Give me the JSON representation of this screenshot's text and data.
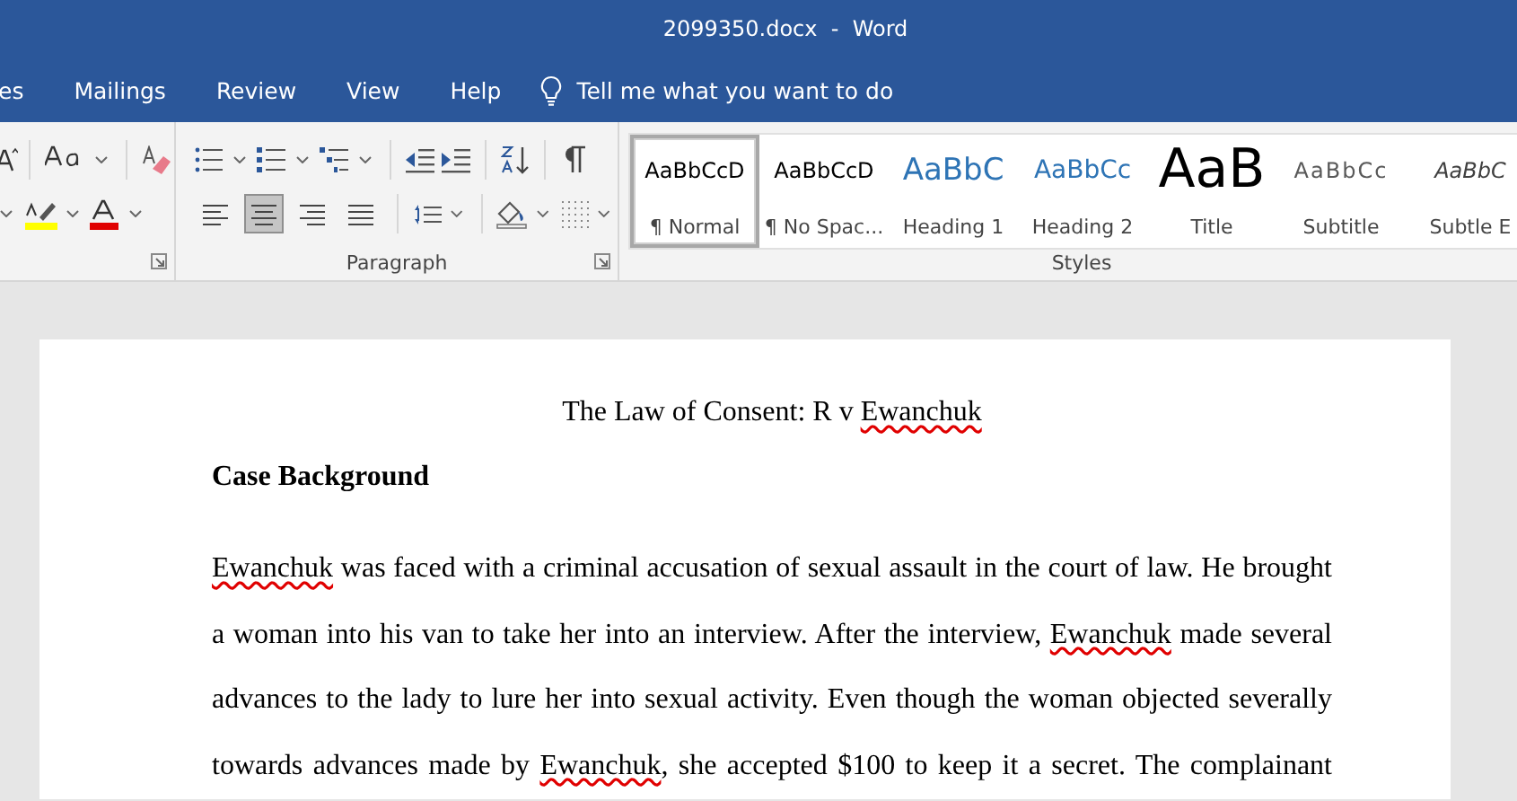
{
  "window": {
    "title": "2099350.docx  -  Word"
  },
  "tabs": [
    {
      "label": "es",
      "selected": false
    },
    {
      "label": "Mailings",
      "selected": false
    },
    {
      "label": "Review",
      "selected": false
    },
    {
      "label": "View",
      "selected": false
    },
    {
      "label": "Help",
      "selected": false
    }
  ],
  "tell_me": {
    "label": "Tell me what you want to do"
  },
  "ribbon": {
    "paragraph": {
      "label": "Paragraph",
      "alignment": [
        {
          "selected": false
        },
        {
          "selected": true
        },
        {
          "selected": false
        },
        {
          "selected": false
        }
      ]
    },
    "styles": {
      "label": "Styles",
      "items": [
        {
          "preview": "AaBbCcD",
          "name": "¶ Normal",
          "kind": "normal",
          "selected": true
        },
        {
          "preview": "AaBbCcD",
          "name": "¶ No Spac...",
          "kind": "normal",
          "selected": false
        },
        {
          "preview": "AaBbC",
          "name": "Heading 1",
          "kind": "heading1",
          "selected": false
        },
        {
          "preview": "AaBbCc",
          "name": "Heading 2",
          "kind": "heading2",
          "selected": false
        },
        {
          "preview": "AaB",
          "name": "Title",
          "kind": "title",
          "selected": false
        },
        {
          "preview": "AaBbCc",
          "name": "Subtitle",
          "kind": "subtitle",
          "selected": false
        },
        {
          "preview": "AaBbC",
          "name": "Subtle E",
          "kind": "emphasis",
          "selected": false
        }
      ]
    }
  },
  "document": {
    "title": [
      {
        "text": "The Law of Consent: R v ",
        "misspelled": false
      },
      {
        "text": "Ewanchuk",
        "misspelled": true
      }
    ],
    "heading": "Case Background",
    "paragraph": [
      {
        "text": "Ewanchuk",
        "misspelled": true
      },
      {
        "text": " was faced with a criminal accusation of sexual assault in the court of law. He brought a woman into his van to take her into an interview. After the interview, ",
        "misspelled": false
      },
      {
        "text": "Ewanchuk",
        "misspelled": true
      },
      {
        "text": " made several advances to the lady to lure her into sexual activity. Even though the woman objected severally towards advances made by ",
        "misspelled": false
      },
      {
        "text": "Ewanchuk",
        "misspelled": true
      },
      {
        "text": ", she accepted $100 to keep it a secret. The complainant",
        "misspelled": false
      }
    ]
  }
}
